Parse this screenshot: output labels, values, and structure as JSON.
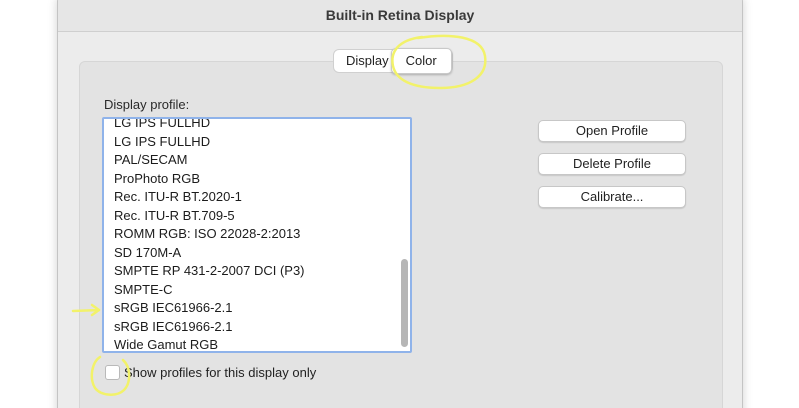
{
  "window": {
    "title": "Built-in Retina Display"
  },
  "tabs": [
    {
      "label": "Display",
      "selected": false
    },
    {
      "label": "Color",
      "selected": true
    }
  ],
  "profile_list": {
    "label": "Display profile:",
    "items": [
      "LG IPS FULLHD",
      "LG IPS FULLHD",
      "PAL/SECAM",
      "ProPhoto RGB",
      "Rec. ITU-R BT.2020-1",
      "Rec. ITU-R BT.709-5",
      "ROMM RGB: ISO 22028-2:2013",
      "SD 170M-A",
      "SMPTE RP 431-2-2007 DCI (P3)",
      "SMPTE-C",
      "sRGB IEC61966-2.1",
      "sRGB IEC61966-2.1",
      "Wide Gamut RGB"
    ]
  },
  "buttons": {
    "open_profile": "Open Profile",
    "delete_profile": "Delete Profile",
    "calibrate": "Calibrate..."
  },
  "checkbox": {
    "label": "Show profiles for this display only",
    "checked": false
  },
  "colors": {
    "annotation": "#f2f26a",
    "list_focus_border": "#8fb3ea"
  }
}
